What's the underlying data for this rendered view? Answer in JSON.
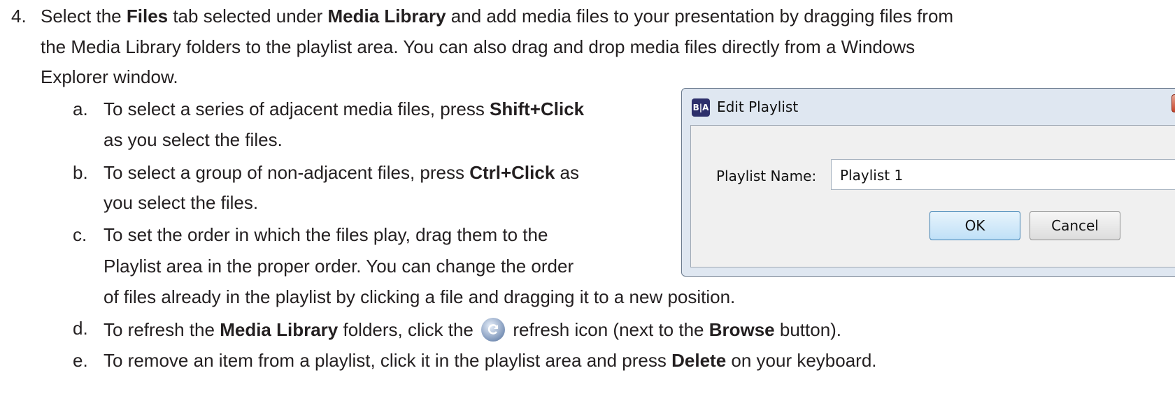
{
  "step4": {
    "num": "4.",
    "t1": "Select the ",
    "b1": "Files",
    "t2": " tab selected under ",
    "b2": "Media Library",
    "t3": " and add media files to your presentation by dragging files from",
    "line2": "the Media Library folders to the playlist area. You can also drag and drop media files directly from a Windows",
    "line3": "Explorer window."
  },
  "items": {
    "a": {
      "marker": "a.",
      "t1": "To select a series of adjacent media files, press ",
      "b1": "Shift+Click",
      "line2": "as you select the files."
    },
    "b": {
      "marker": "b.",
      "t1": "To select a group of non-adjacent files, press ",
      "b1": "Ctrl+Click",
      "t2": " as",
      "line2": "you select the files."
    },
    "c": {
      "marker": "c.",
      "line1": "To set the order in which the files play, drag them to the",
      "line2": "Playlist area in the proper order. You can change the order",
      "line3": "of files already in the playlist by clicking a file and dragging it to a new position."
    },
    "d": {
      "marker": "d.",
      "t1": "To refresh the ",
      "b1": "Media Library",
      "t2": " folders, click the ",
      "t3": " refresh icon (next to the ",
      "b2": "Browse",
      "t4": " button)."
    },
    "e": {
      "marker": "e.",
      "t1": "To remove an item from a playlist, click it in the playlist area and press ",
      "b1": "Delete",
      "t2": " on your keyboard."
    }
  },
  "dialog": {
    "icon_text": "B|A",
    "title": "Edit Playlist",
    "label": "Playlist Name:",
    "input_value": "Playlist 1",
    "ok": "OK",
    "cancel": "Cancel"
  },
  "icons": {
    "refresh": "refresh-icon",
    "app": "app-icon",
    "close": "close-icon"
  }
}
